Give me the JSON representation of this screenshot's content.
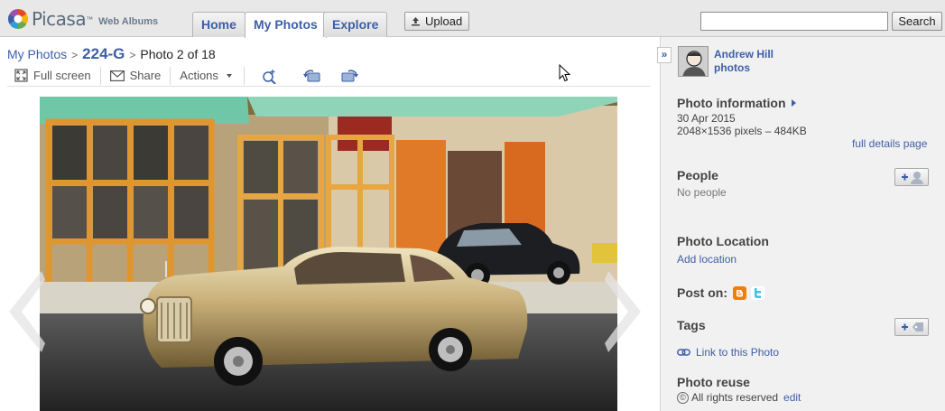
{
  "header": {
    "brand": "Picasa",
    "brand_tm": "™",
    "brand_sub": "Web Albums",
    "tabs": [
      {
        "label": "Home",
        "active": false
      },
      {
        "label": "My Photos",
        "active": true
      },
      {
        "label": "Explore",
        "active": false
      }
    ],
    "upload_label": "Upload",
    "search_value": "",
    "search_button": "Search"
  },
  "breadcrumb": {
    "root": "My Photos",
    "album": "224-G",
    "current": "Photo 2 of 18"
  },
  "toolbar": {
    "fullscreen": "Full screen",
    "share": "Share",
    "actions": "Actions",
    "icons": [
      "zoom-in-icon",
      "rotate-left-icon",
      "rotate-right-icon"
    ]
  },
  "sidebar": {
    "owner_name": "Andrew Hill",
    "owner_photos": "photos",
    "photo_info_title": "Photo information",
    "photo_date": "30 Apr 2015",
    "photo_dims": "2048×1536 pixels – 484KB",
    "full_details": "full details page",
    "people_title": "People",
    "people_none": "No people",
    "location_title": "Photo Location",
    "add_location": "Add location",
    "post_on": "Post on:",
    "tags_title": "Tags",
    "link_photo": "Link to this Photo",
    "reuse_title": "Photo reuse",
    "reuse_text": "All rights reserved",
    "reuse_edit": "edit"
  },
  "colors": {
    "link": "#3d5fa8",
    "panel_bg": "#f1f1f1",
    "topbar_bg": "#e8e8e8"
  }
}
